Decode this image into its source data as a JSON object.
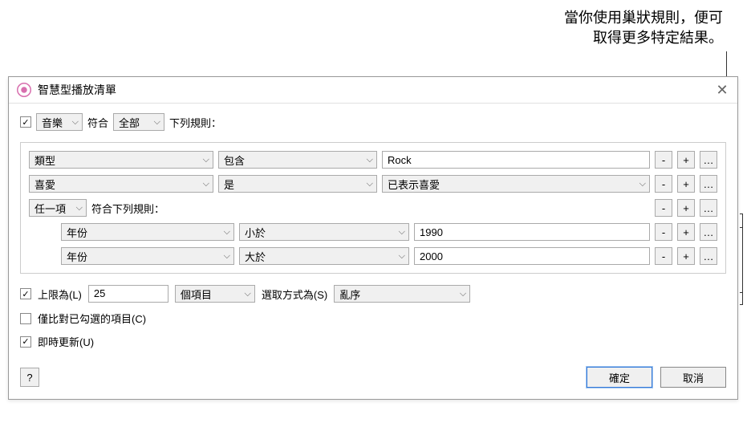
{
  "annotation": {
    "line1": "當你使用巢狀規則，便可",
    "line2": "取得更多特定結果。"
  },
  "dialog": {
    "title": "智慧型播放清單"
  },
  "topRule": {
    "enabled": true,
    "category": "音樂",
    "matchLabel": "符合",
    "matchMode": "全部",
    "suffix": "下列規則："
  },
  "rules": [
    {
      "field": "類型",
      "operator": "包含",
      "valueType": "text",
      "value": "Rock"
    },
    {
      "field": "喜愛",
      "operator": "是",
      "valueType": "select",
      "value": "已表示喜愛"
    }
  ],
  "nested": {
    "mode": "任一項",
    "suffix": "符合下列規則：",
    "rules": [
      {
        "field": "年份",
        "operator": "小於",
        "value": "1990"
      },
      {
        "field": "年份",
        "operator": "大於",
        "value": "2000"
      }
    ]
  },
  "options": {
    "limitEnabled": true,
    "limitLabel": "上限為(L)",
    "limitValue": "25",
    "limitUnit": "個項目",
    "selectByLabel": "選取方式為(S)",
    "selectBy": "亂序",
    "onlyCheckedEnabled": false,
    "onlyCheckedLabel": "僅比對已勾選的項目(C)",
    "liveUpdateEnabled": true,
    "liveUpdateLabel": "即時更新(U)"
  },
  "buttons": {
    "remove": "-",
    "add": "+",
    "more": "…",
    "help": "?",
    "ok": "確定",
    "cancel": "取消"
  }
}
